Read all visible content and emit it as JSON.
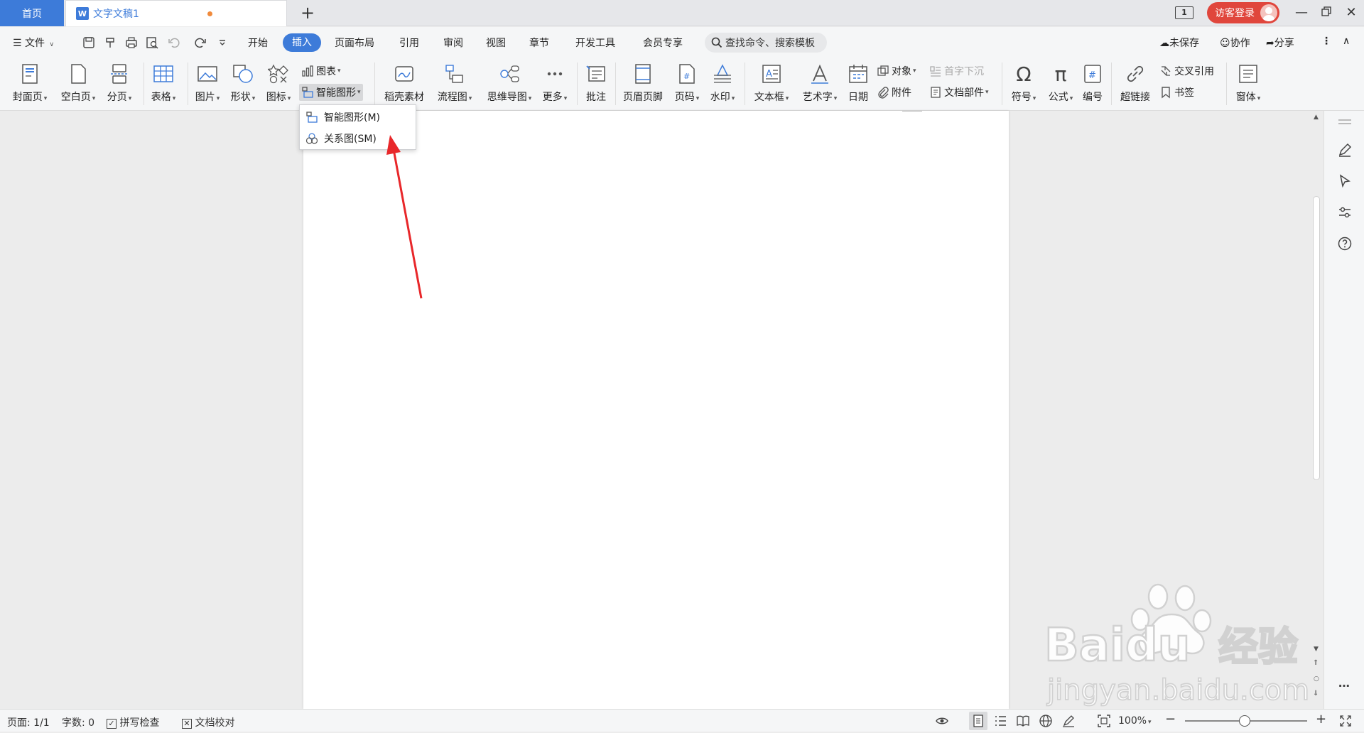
{
  "titlebar": {
    "home_tab": "首页",
    "doc_tab": "文字文稿1",
    "doc_icon_letter": "W",
    "window_badge": "1",
    "login_label": "访客登录"
  },
  "menubar": {
    "file_label": "文件",
    "tabs": [
      "开始",
      "插入",
      "页面布局",
      "引用",
      "审阅",
      "视图",
      "章节",
      "开发工具",
      "会员专享"
    ],
    "active_tab": "插入",
    "search_placeholder": "查找命令、搜索模板",
    "unsaved_label": "未保存",
    "collab_label": "协作",
    "share_label": "分享"
  },
  "ribbon": {
    "cover_page": "封面页",
    "blank_page": "空白页",
    "page_break": "分页",
    "table": "表格",
    "picture": "图片",
    "shape": "形状",
    "icon": "图标",
    "chart": "图表",
    "smart_art": "智能图形",
    "docer_material": "稻壳素材",
    "flowchart": "流程图",
    "mindmap": "思维导图",
    "more": "更多",
    "comment": "批注",
    "header_footer": "页眉页脚",
    "page_number": "页码",
    "watermark": "水印",
    "textbox": "文本框",
    "wordart": "艺术字",
    "date": "日期",
    "object": "对象",
    "attachment": "附件",
    "drop_cap": "首字下沉",
    "doc_parts": "文档部件",
    "symbol": "符号",
    "formula": "公式",
    "numbering": "编号",
    "hyperlink": "超链接",
    "cross_ref": "交叉引用",
    "bookmark": "书签",
    "form": "窗体"
  },
  "dropdown": {
    "items": [
      {
        "label": "智能图形(M)",
        "icon": "smartart-icon"
      },
      {
        "label": "关系图(SM)",
        "icon": "relation-diagram-icon"
      }
    ]
  },
  "statusbar": {
    "page": "页面: 1/1",
    "word_count": "字数: 0",
    "spell_check": "拼写检查",
    "doc_proofread": "文档校对",
    "zoom": "100%"
  },
  "watermark": {
    "brand": "Baidu",
    "brand_cn": "经验",
    "url": "jingyan.baidu.com"
  },
  "colors": {
    "accent": "#3d7bd9",
    "login": "#e0463c",
    "arrow": "#e8272a"
  }
}
